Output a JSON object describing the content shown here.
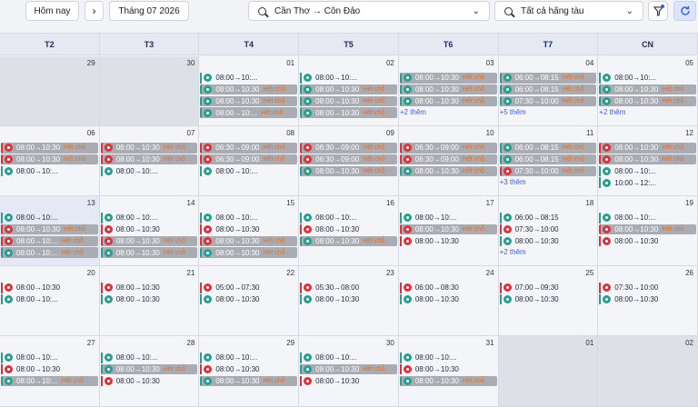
{
  "toolbar": {
    "today_label": "Hôm nay",
    "next_icon": "chevron-right-icon",
    "month_label": "Tháng 07 2026",
    "route_label": "Cần Thơ → Côn Đảo",
    "airline_label": "Tất cả hãng tàu",
    "colors": {
      "accent": "#3b5bdb",
      "full_bg": "#a9acb2",
      "status": "#e36f2c"
    }
  },
  "weekdays": [
    "T2",
    "T3",
    "T4",
    "T5",
    "T6",
    "T7",
    "CN"
  ],
  "status_full": "Hết chỗ",
  "weeks": [
    [
      {
        "day": "29",
        "other": true,
        "events": []
      },
      {
        "day": "30",
        "other": true,
        "events": []
      },
      {
        "day": "01",
        "events": [
          {
            "time": "08:00→10:...",
            "op": "vn",
            "full": false
          },
          {
            "time": "08:00→10:30",
            "op": "vn",
            "full": true
          },
          {
            "time": "08:00→10:30",
            "op": "vn",
            "full": true
          },
          {
            "time": "08:00→10:...",
            "op": "vn",
            "full": true
          }
        ]
      },
      {
        "day": "02",
        "events": [
          {
            "time": "08:00→10:...",
            "op": "vn",
            "full": false
          },
          {
            "time": "08:00→10:30",
            "op": "vn",
            "full": true
          },
          {
            "time": "08:00→10:30",
            "op": "vn",
            "full": true
          },
          {
            "time": "08:00→10:30",
            "op": "vn",
            "full": true
          }
        ]
      },
      {
        "day": "03",
        "events": [
          {
            "time": "08:00→10:30",
            "op": "vn",
            "full": true
          },
          {
            "time": "08:00→10:30",
            "op": "vn",
            "full": true
          },
          {
            "time": "08:00→10:30",
            "op": "vn",
            "full": true
          }
        ],
        "more": "+2 thêm"
      },
      {
        "day": "04",
        "events": [
          {
            "time": "06:00→08:15",
            "op": "vn",
            "full": true
          },
          {
            "time": "06:00→08:15",
            "op": "vn",
            "full": true
          },
          {
            "time": "07:30→10:00",
            "op": "vn",
            "full": true
          }
        ],
        "more": "+5 thêm"
      },
      {
        "day": "05",
        "events": [
          {
            "time": "08:00→10:...",
            "op": "vn",
            "full": false
          },
          {
            "time": "08:00→10:30",
            "op": "vn",
            "full": true
          },
          {
            "time": "08:00→10:30",
            "op": "vn",
            "full": true
          }
        ],
        "more": "+2 thêm"
      }
    ],
    [
      {
        "day": "06",
        "events": [
          {
            "time": "08:00→10:30",
            "op": "vj",
            "full": true
          },
          {
            "time": "08:00→10:30",
            "op": "vj",
            "full": true
          },
          {
            "time": "08:00→10:...",
            "op": "vn",
            "full": false
          }
        ]
      },
      {
        "day": "07",
        "events": [
          {
            "time": "08:00→10:30",
            "op": "vj",
            "full": true
          },
          {
            "time": "08:00→10:30",
            "op": "vj",
            "full": true
          },
          {
            "time": "08:00→10:...",
            "op": "vn",
            "full": false
          }
        ]
      },
      {
        "day": "08",
        "events": [
          {
            "time": "06:30→09:00",
            "op": "vj",
            "full": true
          },
          {
            "time": "06:30→09:00",
            "op": "vj",
            "full": true
          },
          {
            "time": "08:00→10:...",
            "op": "vn",
            "full": false
          }
        ]
      },
      {
        "day": "09",
        "events": [
          {
            "time": "06:30→09:00",
            "op": "vj",
            "full": true
          },
          {
            "time": "06:30→09:00",
            "op": "vj",
            "full": true
          },
          {
            "time": "08:00→10:30",
            "op": "vn",
            "full": true
          }
        ]
      },
      {
        "day": "10",
        "events": [
          {
            "time": "06:30→09:00",
            "op": "vj",
            "full": true
          },
          {
            "time": "06:30→09:00",
            "op": "vj",
            "full": true
          },
          {
            "time": "08:00→10:30",
            "op": "vn",
            "full": true
          }
        ]
      },
      {
        "day": "11",
        "events": [
          {
            "time": "06:00→08:15",
            "op": "vn",
            "full": true
          },
          {
            "time": "06:00→08:15",
            "op": "vn",
            "full": true
          },
          {
            "time": "07:30→10:00",
            "op": "vj",
            "full": true
          }
        ],
        "more": "+3 thêm"
      },
      {
        "day": "12",
        "events": [
          {
            "time": "08:00→10:30",
            "op": "vj",
            "full": true
          },
          {
            "time": "08:00→10:30",
            "op": "vj",
            "full": true
          },
          {
            "time": "08:00→10:...",
            "op": "vn",
            "full": false
          },
          {
            "time": "10:00→12:...",
            "op": "vn",
            "full": false
          }
        ]
      }
    ],
    [
      {
        "day": "13",
        "today": true,
        "events": [
          {
            "time": "08:00→10:...",
            "op": "vn",
            "full": false
          },
          {
            "time": "08:00→10:30",
            "op": "vj",
            "full": true
          },
          {
            "time": "08:00→10:...",
            "op": "vj",
            "full": true
          },
          {
            "time": "08:00→10:...",
            "op": "vn",
            "full": true
          }
        ]
      },
      {
        "day": "14",
        "events": [
          {
            "time": "08:00→10:...",
            "op": "vn",
            "full": false
          },
          {
            "time": "08:00→10:30",
            "op": "vj",
            "full": false
          },
          {
            "time": "08:00→10:30",
            "op": "vj",
            "full": true
          },
          {
            "time": "08:00→10:30",
            "op": "vn",
            "full": true
          }
        ]
      },
      {
        "day": "15",
        "events": [
          {
            "time": "08:00→10:...",
            "op": "vn",
            "full": false
          },
          {
            "time": "08:00→10:30",
            "op": "vj",
            "full": false
          },
          {
            "time": "08:00→10:30",
            "op": "vj",
            "full": true
          },
          {
            "time": "08:00→10:30",
            "op": "vn",
            "full": true
          }
        ]
      },
      {
        "day": "16",
        "events": [
          {
            "time": "08:00→10:...",
            "op": "vn",
            "full": false
          },
          {
            "time": "08:00→10:30",
            "op": "vj",
            "full": false
          },
          {
            "time": "08:00→10:30",
            "op": "vn",
            "full": true
          }
        ]
      },
      {
        "day": "17",
        "events": [
          {
            "time": "08:00→10:...",
            "op": "vn",
            "full": false
          },
          {
            "time": "08:00→10:30",
            "op": "vj",
            "full": true
          },
          {
            "time": "08:00→10:30",
            "op": "vj",
            "full": false
          }
        ]
      },
      {
        "day": "18",
        "events": [
          {
            "time": "06:00→08:15",
            "op": "vn",
            "full": false
          },
          {
            "time": "07:30→10:00",
            "op": "vj",
            "full": false
          },
          {
            "time": "08:00→10:30",
            "op": "vn",
            "full": false
          }
        ],
        "more": "+2 thêm"
      },
      {
        "day": "19",
        "events": [
          {
            "time": "08:00→10:...",
            "op": "vn",
            "full": false
          },
          {
            "time": "08:00→10:30",
            "op": "vj",
            "full": true
          },
          {
            "time": "08:00→10:30",
            "op": "vj",
            "full": false
          }
        ]
      }
    ],
    [
      {
        "day": "20",
        "events": [
          {
            "time": "08:00→10:30",
            "op": "vj",
            "full": false
          },
          {
            "time": "08:00→10:...",
            "op": "vn",
            "full": false
          }
        ]
      },
      {
        "day": "21",
        "events": [
          {
            "time": "08:00→10:30",
            "op": "vj",
            "full": false
          },
          {
            "time": "08:00→10:30",
            "op": "vn",
            "full": false
          }
        ]
      },
      {
        "day": "22",
        "events": [
          {
            "time": "05:00→07:30",
            "op": "vj",
            "full": false
          },
          {
            "time": "08:00→10:30",
            "op": "vn",
            "full": false
          }
        ]
      },
      {
        "day": "23",
        "events": [
          {
            "time": "05:30→08:00",
            "op": "vj",
            "full": false
          },
          {
            "time": "08:00→10:30",
            "op": "vn",
            "full": false
          }
        ]
      },
      {
        "day": "24",
        "events": [
          {
            "time": "06:00→08:30",
            "op": "vj",
            "full": false
          },
          {
            "time": "08:00→10:30",
            "op": "vn",
            "full": false
          }
        ]
      },
      {
        "day": "25",
        "events": [
          {
            "time": "07:00→09:30",
            "op": "vj",
            "full": false
          },
          {
            "time": "08:00→10:30",
            "op": "vn",
            "full": false
          }
        ]
      },
      {
        "day": "26",
        "events": [
          {
            "time": "07:30→10:00",
            "op": "vj",
            "full": false
          },
          {
            "time": "08:00→10:30",
            "op": "vn",
            "full": false
          }
        ]
      }
    ],
    [
      {
        "day": "27",
        "events": [
          {
            "time": "08:00→10:...",
            "op": "vn",
            "full": false
          },
          {
            "time": "08:00→10:30",
            "op": "vj",
            "full": false
          },
          {
            "time": "08:00→10:...",
            "op": "vn",
            "full": true
          }
        ]
      },
      {
        "day": "28",
        "events": [
          {
            "time": "08:00→10:...",
            "op": "vn",
            "full": false
          },
          {
            "time": "08:00→10:30",
            "op": "vn",
            "full": true
          },
          {
            "time": "08:00→10:30",
            "op": "vj",
            "full": false
          }
        ]
      },
      {
        "day": "29",
        "events": [
          {
            "time": "08:00→10:...",
            "op": "vn",
            "full": false
          },
          {
            "time": "08:00→10:30",
            "op": "vj",
            "full": false
          },
          {
            "time": "08:00→10:30",
            "op": "vn",
            "full": true
          }
        ]
      },
      {
        "day": "30",
        "events": [
          {
            "time": "08:00→10:...",
            "op": "vn",
            "full": false
          },
          {
            "time": "08:00→10:30",
            "op": "vn",
            "full": true
          },
          {
            "time": "08:00→10:30",
            "op": "vj",
            "full": false
          }
        ]
      },
      {
        "day": "31",
        "events": [
          {
            "time": "08:00→10:...",
            "op": "vn",
            "full": false
          },
          {
            "time": "08:00→10:30",
            "op": "vj",
            "full": false
          },
          {
            "time": "08:00→10:30",
            "op": "vn",
            "full": true
          }
        ]
      },
      {
        "day": "01",
        "other": true,
        "events": []
      },
      {
        "day": "02",
        "other": true,
        "events": []
      }
    ]
  ]
}
